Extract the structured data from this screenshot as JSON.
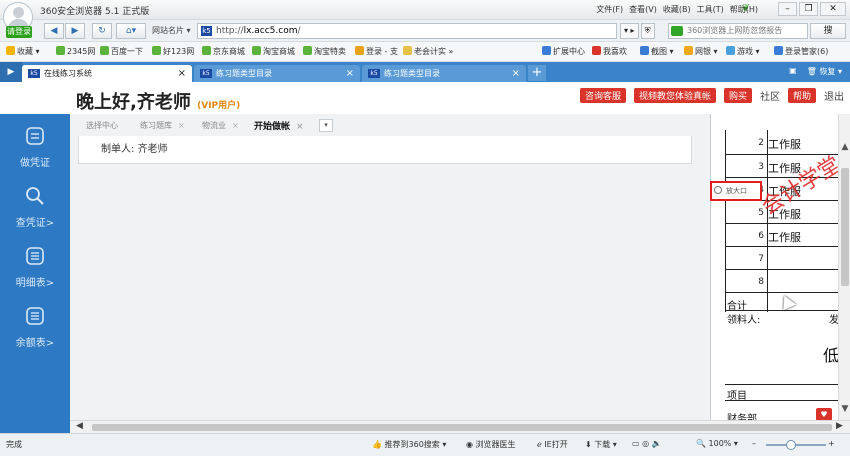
{
  "browser": {
    "title": "360安全浏览器 5.1 正式版",
    "login_label": "请登录",
    "menus": [
      "文件(F)",
      "查看(V)",
      "收藏(B)",
      "工具(T)",
      "帮助(H)"
    ],
    "site_name": "网站名片",
    "url_prefix": "http://",
    "url_domain": "lx.acc5.com",
    "url_suffix": "/",
    "search_placeholder": "360浏览器上网防忽悠报告",
    "search_button": "搜",
    "bookmarks": [
      "收藏",
      "2345网",
      "百度一下",
      "好123网",
      "京东商城",
      "淘宝商城",
      "淘宝特卖",
      "登录 - 支",
      "老会计实"
    ],
    "bookmarks_right": [
      "扩展中心",
      "我喜欢",
      "截图",
      "网银",
      "游戏",
      "登录管家(6)"
    ],
    "tabs": [
      {
        "label": "在线练习系统",
        "active": true
      },
      {
        "label": "练习题类型目录",
        "active": false
      },
      {
        "label": "练习题类型目录",
        "active": false
      }
    ],
    "tab_right": [
      "恢复"
    ],
    "status": "完成",
    "status_items": [
      "推荐到360搜索",
      "浏览器医生",
      "IE打开",
      "下载"
    ],
    "zoom": "100%"
  },
  "header": {
    "greeting": "晚上好,齐老师",
    "vip": "(VIP用户)",
    "links_red": [
      "咨询客服",
      "视频教您体验真帐",
      "购买"
    ],
    "links_plain": [
      "社区"
    ],
    "help": "帮助",
    "logout": "退出"
  },
  "sidebar": {
    "items": [
      "做凭证",
      "查凭证>",
      "明细表>",
      "余额表>"
    ]
  },
  "content": {
    "subtabs": [
      "选择中心",
      "练习题库",
      "物流业",
      "开始做帐"
    ],
    "preparer_label": "制单人:",
    "preparer_name": "齐老师"
  },
  "document": {
    "rows": [
      {
        "no": "2",
        "item": "工作服"
      },
      {
        "no": "3",
        "item": "工作服"
      },
      {
        "no": "4",
        "item": "工作服"
      },
      {
        "no": "5",
        "item": "工作服"
      },
      {
        "no": "6",
        "item": "工作服"
      },
      {
        "no": "7",
        "item": ""
      },
      {
        "no": "8",
        "item": ""
      }
    ],
    "total_label": "合计",
    "receiver_label": "领料人:",
    "issuer_fragment": "发",
    "low_char": "低",
    "item_label": "项目",
    "dept_label": "财务部",
    "watermark": "会计学堂",
    "magnifier_text": "放大口"
  }
}
